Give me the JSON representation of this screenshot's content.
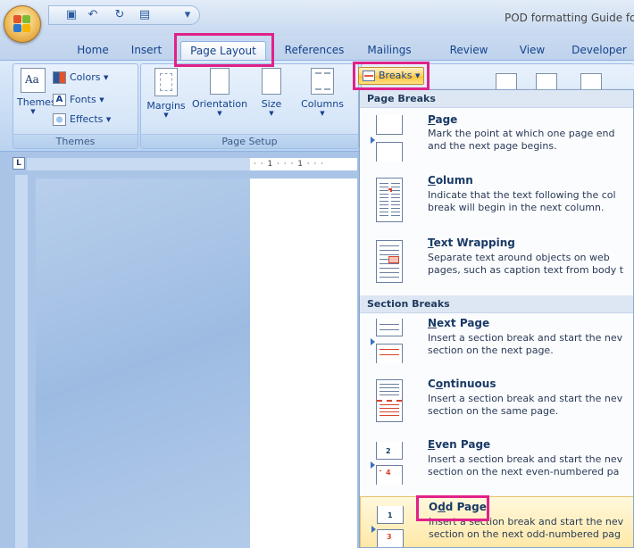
{
  "window": {
    "title": "POD formatting Guide fo"
  },
  "quick_access": {
    "items": [
      {
        "name": "save-icon",
        "glyph": "▣"
      },
      {
        "name": "undo-icon",
        "glyph": "↶"
      },
      {
        "name": "redo-icon",
        "glyph": "↻"
      },
      {
        "name": "paste-icon",
        "glyph": "▤"
      },
      {
        "name": "customize-icon",
        "glyph": "▾"
      }
    ]
  },
  "tabs": [
    "Home",
    "Insert",
    "Page Layout",
    "References",
    "Mailings",
    "Review",
    "View",
    "Developer"
  ],
  "active_tab": "Page Layout",
  "ribbon": {
    "themes_group": {
      "label": "Themes",
      "themes_button": "Themes",
      "colors_button": "Colors",
      "fonts_button": "Fonts",
      "effects_button": "Effects",
      "theme_icon_text": "Aa",
      "fonts_icon_text": "A"
    },
    "page_setup_group": {
      "label": "Page Setup",
      "margins_button": "Margins",
      "orientation_button": "Orientation",
      "size_button": "Size",
      "columns_button": "Columns",
      "breaks_button": "Breaks"
    }
  },
  "ruler": {
    "corner_label": "L",
    "marks": "· · 1 · · · 1 · · ·"
  },
  "menu": {
    "page_breaks_header": "Page Breaks",
    "section_breaks_header": "Section Breaks",
    "items": [
      {
        "title": "Page",
        "accel": "P",
        "rest": "age",
        "desc1": "Mark the point at which one page end",
        "desc2": "and the next page begins."
      },
      {
        "title": "Column",
        "accel": "C",
        "rest": "olumn",
        "desc1": "Indicate that the text following the col",
        "desc2": "break will begin in the next column."
      },
      {
        "title": "Text Wrapping",
        "accel": "T",
        "rest": "ext Wrapping",
        "desc1": "Separate text around objects on web",
        "desc2": "pages, such as caption text from body t"
      },
      {
        "title": "Next Page",
        "accel": "N",
        "rest": "ext Page",
        "desc1": "Insert a section break and start the nev",
        "desc2": "section on the next page."
      },
      {
        "title": "Continuous",
        "accel": "o",
        "pre": "C",
        "rest": "ntinuous",
        "desc1": "Insert a section break and start the nev",
        "desc2": "section on the same page."
      },
      {
        "title": "Even Page",
        "accel": "E",
        "rest": "ven Page",
        "desc1": "Insert a section break and start the nev",
        "desc2": "section on the next even-numbered pa"
      },
      {
        "title": "Odd Page",
        "accel": "d",
        "pre": "O",
        "rest": "d Page",
        "desc1": "Insert a section break and start the nev",
        "desc2": "section on the next odd-numbered pag"
      }
    ],
    "icon_numbers": {
      "even_top": "2",
      "even_bottom": "4",
      "odd_top": "1",
      "odd_bottom": "3"
    }
  },
  "colors": {
    "highlight": "#e0218a",
    "accent": "#15428b"
  }
}
